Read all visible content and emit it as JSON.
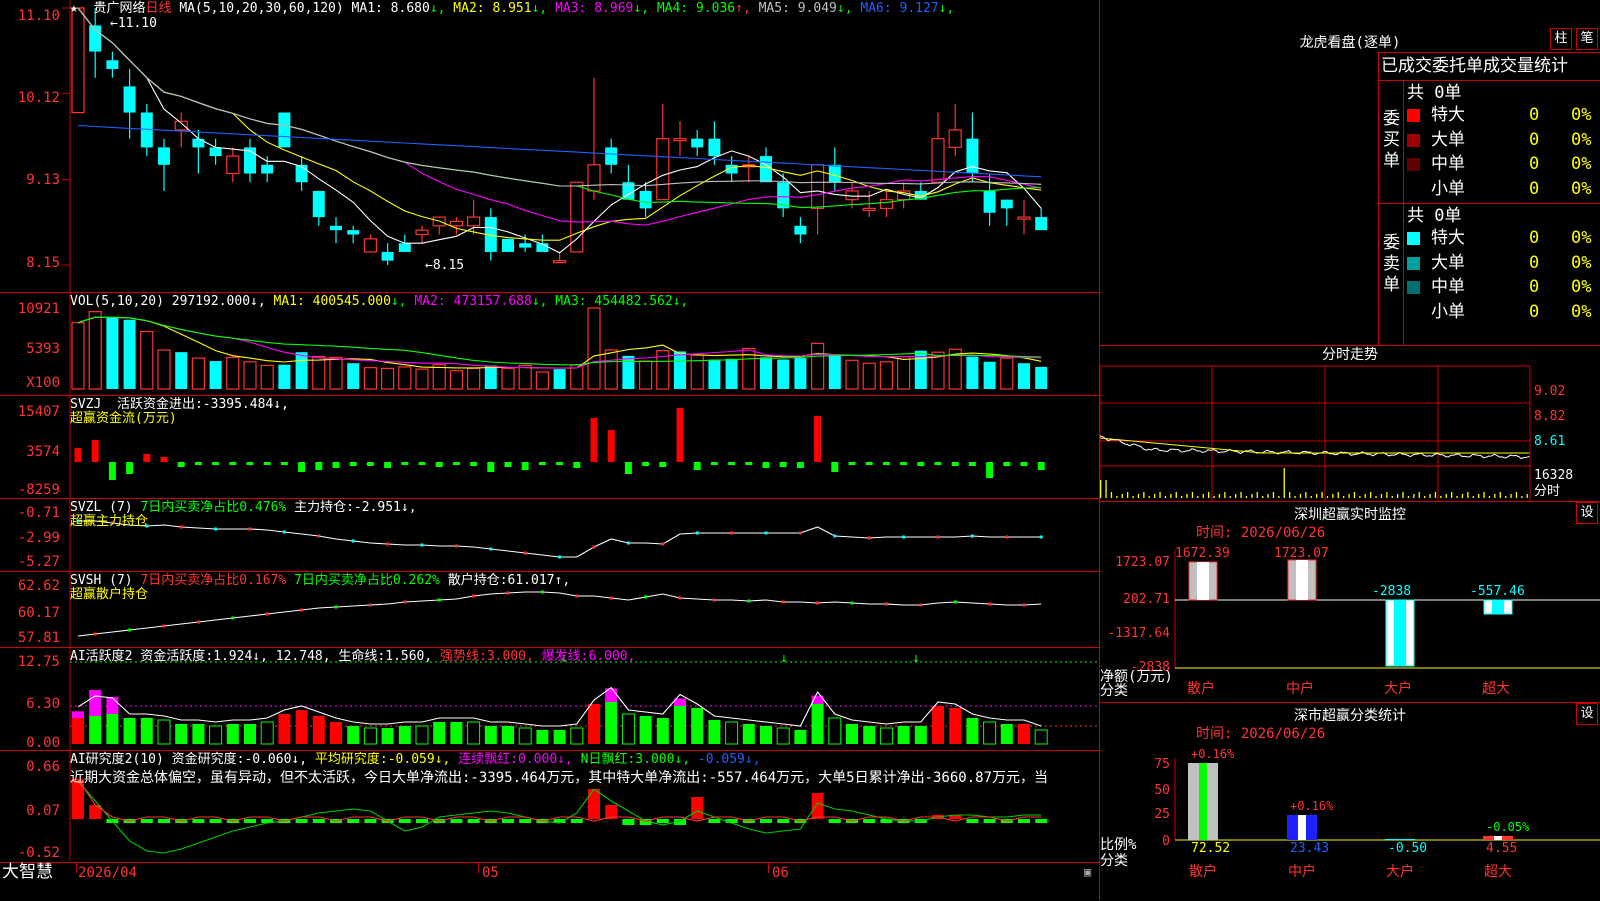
{
  "stock": {
    "name": "贵广网络",
    "period": "日线"
  },
  "panel1": {
    "ma_header": "MA(5,10,20,30,60,120)",
    "ma": [
      {
        "label": "MA1:",
        "value": "8.680",
        "arrow": "↓",
        "color": "#ffffff"
      },
      {
        "label": "MA2:",
        "value": "8.951",
        "arrow": "↓",
        "color": "#ffff00"
      },
      {
        "label": "MA3:",
        "value": "8.969",
        "arrow": "↓",
        "color": "#ff00ff"
      },
      {
        "label": "MA4:",
        "value": "9.036",
        "arrow": "↑",
        "color": "#00ff00"
      },
      {
        "label": "MA5:",
        "value": "9.049",
        "arrow": "↓",
        "color": "#c0c0c0"
      },
      {
        "label": "MA6:",
        "value": "9.127",
        "arrow": "↓",
        "color": "#2060ff"
      }
    ],
    "yticks": [
      "11.10",
      "10.12",
      "9.13",
      "8.15"
    ],
    "high_label": "11.10",
    "low_label": "8.15"
  },
  "panel2": {
    "title": "VOL(5,10,20)",
    "value": "297192.000",
    "ma": [
      {
        "label": "MA1:",
        "value": "400545.000",
        "arrow": "↓",
        "color": "#ffff00"
      },
      {
        "label": "MA2:",
        "value": "473157.688",
        "arrow": "↓",
        "color": "#ff00ff"
      },
      {
        "label": "MA3:",
        "value": "454482.562",
        "arrow": "↓",
        "color": "#00ff00"
      }
    ],
    "yticks": [
      "10921",
      "5393",
      "X100"
    ]
  },
  "panel3": {
    "title": "SVZJ",
    "line1": "活跃资金进出:-3395.484↓,",
    "line2": "超赢资金流(万元)",
    "yticks": [
      "15407",
      "3574",
      "-8259"
    ]
  },
  "panel4": {
    "title": "SVZL (7)",
    "t1": "7日内买卖净占比0.476%",
    "t2": "主力持仓:-2.951↓,",
    "line2": "超赢主力持仓",
    "yticks": [
      "-0.71",
      "-2.99",
      "-5.27"
    ]
  },
  "panel5": {
    "title": "SVSH (7)",
    "t1": "7日内买卖净占比0.167%",
    "t2": "7日内买卖净占比0.262%",
    "t3": "散户持仓:61.017↑,",
    "line2": "超赢散户持仓",
    "yticks": [
      "62.62",
      "60.17",
      "57.81"
    ]
  },
  "panel6": {
    "title": "AI活跃度2",
    "t1": "资金活跃度:1.924↓,",
    "t2": "12.748,",
    "t3": "生命线:1.560,",
    "t4": "强势线:3.000,",
    "t5": "爆发线:6.000,",
    "yticks": [
      "12.75",
      "6.30",
      "0.00"
    ]
  },
  "panel7": {
    "title": "AI研究度2(10)",
    "t1": "资金研究度:-0.060↓,",
    "t2": "平均研究度:-0.059↓,",
    "t3": "连续飘红:0.000↓,",
    "t4": "N日飘红:3.000↓,",
    "t5": "-0.059↓,",
    "comment": "近期大资金总体偏空，虽有异动，但不太活跃，今日大单净流出:-3395.464万元，其中特大单净流出:-557.464万元，大单5日累计净出-3660.87万元，当",
    "yticks": [
      "0.66",
      "0.07",
      "-0.52"
    ]
  },
  "bottom": {
    "brand": "大智慧",
    "date": "2026/04",
    "m1": "05",
    "m2": "06"
  },
  "dragon": {
    "title": "龙虎看盘(逐单)",
    "btn1": "柱",
    "btn2": "笔",
    "header": "已成交委托单成交量统计",
    "buy_label": "委买单",
    "sell_label": "委卖单",
    "buy_total": "共 0单",
    "sell_total": "共 0单",
    "buy_rows": [
      {
        "name": "特大",
        "count": "0",
        "pct": "0%",
        "color": "#ff0000"
      },
      {
        "name": "大单",
        "count": "0",
        "pct": "0%",
        "color": "#a00000"
      },
      {
        "name": "中单",
        "count": "0",
        "pct": "0%",
        "color": "#600000"
      },
      {
        "name": "小单",
        "count": "0",
        "pct": "0%",
        "color": "#000000"
      }
    ],
    "sell_rows": [
      {
        "name": "特大",
        "count": "0",
        "pct": "0%",
        "color": "#00ffff"
      },
      {
        "name": "大单",
        "count": "0",
        "pct": "0%",
        "color": "#00a0a0"
      },
      {
        "name": "中单",
        "count": "0",
        "pct": "0%",
        "color": "#007070"
      },
      {
        "name": "小单",
        "count": "0",
        "pct": "0%",
        "color": "#000000"
      }
    ]
  },
  "intraday": {
    "title": "分时走势",
    "yticks": [
      "9.02",
      "8.82",
      "8.61",
      "16328",
      "分时"
    ]
  },
  "monitor": {
    "title": "深圳超赢实时监控",
    "gear": "设",
    "time": "时间: 2026/06/26",
    "yticks": [
      "1723.07",
      "202.71",
      "-1317.64",
      "-2838"
    ],
    "ylabel": "净额(万元)",
    "xlabel": "分类",
    "bars": [
      {
        "cat": "散户",
        "label": "1672.39",
        "label_color": "#ff3333"
      },
      {
        "cat": "中户",
        "label": "1723.07",
        "label_color": "#ff3333"
      },
      {
        "cat": "大户",
        "label": "-2838",
        "label_color": "#00ffff"
      },
      {
        "cat": "超大",
        "label": "-557.46",
        "label_color": "#00ffff"
      }
    ]
  },
  "classify": {
    "title": "深市超赢分类统计",
    "gear": "设",
    "time": "时间: 2026/06/26",
    "yticks": [
      "75",
      "50",
      "25",
      "0"
    ],
    "ylabel": "比例%",
    "xlabel": "分类",
    "bars": [
      {
        "cat": "散户",
        "top": "+0.16%",
        "value": "72.52",
        "top_color": "#ff3333",
        "value_color": "#ffff00"
      },
      {
        "cat": "中户",
        "top": "+0.16%",
        "value": "23.43",
        "top_color": "#ff3333",
        "value_color": "#2060ff"
      },
      {
        "cat": "大户",
        "top": "",
        "value": "-0.50",
        "top_color": "#ff3333",
        "value_color": "#00ffff"
      },
      {
        "cat": "超大",
        "top": "-0.05%",
        "value": "4.55",
        "top_color": "#00ff00",
        "value_color": "#ff3333"
      }
    ]
  },
  "chart_data": [
    {
      "type": "candlestick",
      "title": "贵广网络 日线",
      "ylim": [
        8.0,
        11.3
      ],
      "candles": [
        [
          9.9,
          11.1,
          9.9,
          11.1
        ],
        [
          10.9,
          11.1,
          10.3,
          10.6
        ],
        [
          10.5,
          10.6,
          10.3,
          10.4
        ],
        [
          10.2,
          10.4,
          9.6,
          9.9
        ],
        [
          9.9,
          10.0,
          9.4,
          9.5
        ],
        [
          9.5,
          9.6,
          9.0,
          9.3
        ],
        [
          9.7,
          9.9,
          9.5,
          9.8
        ],
        [
          9.6,
          9.7,
          9.2,
          9.5
        ],
        [
          9.5,
          9.6,
          9.3,
          9.4
        ],
        [
          9.2,
          9.5,
          9.1,
          9.4
        ],
        [
          9.5,
          9.6,
          9.1,
          9.2
        ],
        [
          9.3,
          9.4,
          9.1,
          9.2
        ],
        [
          9.9,
          9.9,
          9.5,
          9.5
        ],
        [
          9.3,
          9.4,
          9.0,
          9.1
        ],
        [
          9.0,
          9.0,
          8.6,
          8.7
        ],
        [
          8.6,
          8.7,
          8.4,
          8.55
        ],
        [
          8.55,
          8.6,
          8.4,
          8.5
        ],
        [
          8.3,
          8.5,
          8.3,
          8.45
        ],
        [
          8.3,
          8.4,
          8.15,
          8.2
        ],
        [
          8.4,
          8.5,
          8.3,
          8.3
        ],
        [
          8.5,
          8.6,
          8.4,
          8.55
        ],
        [
          8.6,
          8.7,
          8.5,
          8.7
        ],
        [
          8.6,
          8.7,
          8.5,
          8.65
        ],
        [
          8.6,
          8.9,
          8.5,
          8.7
        ],
        [
          8.7,
          8.8,
          8.2,
          8.3
        ],
        [
          8.45,
          8.45,
          8.3,
          8.3
        ],
        [
          8.4,
          8.5,
          8.3,
          8.35
        ],
        [
          8.4,
          8.5,
          8.35,
          8.3
        ],
        [
          8.2,
          8.3,
          8.2,
          8.2
        ],
        [
          8.3,
          9.1,
          8.3,
          9.1
        ],
        [
          9.0,
          10.3,
          8.9,
          9.3
        ],
        [
          9.5,
          9.6,
          9.2,
          9.3
        ],
        [
          9.1,
          9.3,
          8.9,
          8.9
        ],
        [
          9.0,
          9.1,
          8.7,
          8.8
        ],
        [
          8.9,
          10.0,
          8.9,
          9.6
        ],
        [
          9.6,
          9.8,
          9.4,
          9.6
        ],
        [
          9.6,
          9.7,
          9.4,
          9.5
        ],
        [
          9.6,
          9.8,
          9.3,
          9.4
        ],
        [
          9.3,
          9.4,
          9.1,
          9.2
        ],
        [
          9.3,
          9.4,
          9.1,
          9.3
        ],
        [
          9.4,
          9.5,
          9.1,
          9.1
        ],
        [
          9.1,
          9.2,
          8.7,
          8.8
        ],
        [
          8.6,
          8.7,
          8.4,
          8.5
        ],
        [
          8.8,
          9.3,
          8.5,
          9.3
        ],
        [
          9.3,
          9.5,
          9.0,
          9.1
        ],
        [
          8.9,
          9.1,
          8.8,
          9.0
        ],
        [
          8.8,
          9.0,
          8.7,
          8.8
        ],
        [
          8.8,
          9.0,
          8.7,
          8.9
        ],
        [
          8.9,
          9.1,
          8.8,
          9.0
        ],
        [
          9.0,
          9.1,
          8.9,
          8.9
        ],
        [
          9.1,
          9.9,
          9.1,
          9.6
        ],
        [
          9.5,
          10.0,
          9.4,
          9.7
        ],
        [
          9.6,
          9.9,
          9.1,
          9.2
        ],
        [
          9.0,
          9.2,
          8.6,
          8.75
        ],
        [
          8.9,
          8.9,
          8.6,
          8.8
        ],
        [
          8.7,
          8.9,
          8.5,
          8.7
        ],
        [
          8.7,
          8.8,
          8.6,
          8.55
        ]
      ]
    },
    {
      "type": "bar",
      "title": "VOL(5,10,20)",
      "ylim": [
        0,
        11000
      ],
      "values": [
        9000,
        10500,
        9700,
        9400,
        7800,
        5300,
        5000,
        4200,
        3800,
        4300,
        3700,
        3200,
        3300,
        5000,
        4400,
        4300,
        3500,
        2900,
        2800,
        3000,
        2700,
        3300,
        2500,
        2800,
        3200,
        2800,
        3200,
        2300,
        2700,
        3300,
        11000,
        5300,
        4500,
        3800,
        5200,
        5100,
        4600,
        4000,
        4100,
        5500,
        4300,
        4000,
        4200,
        6200,
        4600,
        3900,
        3500,
        3700,
        4400,
        5200,
        5000,
        5400,
        4400,
        3700,
        4200,
        3500,
        3000
      ],
      "up": [
        1,
        1,
        0,
        0,
        1,
        1,
        0,
        1,
        0,
        1,
        1,
        1,
        0,
        0,
        1,
        1,
        0,
        1,
        1,
        1,
        1,
        1,
        1,
        1,
        0,
        1,
        1,
        1,
        0,
        1,
        1,
        1,
        0,
        1,
        1,
        0,
        1,
        0,
        0,
        1,
        0,
        0,
        0,
        1,
        0,
        1,
        1,
        1,
        1,
        0,
        1,
        1,
        0,
        0,
        1,
        0,
        0
      ]
    }
  ]
}
